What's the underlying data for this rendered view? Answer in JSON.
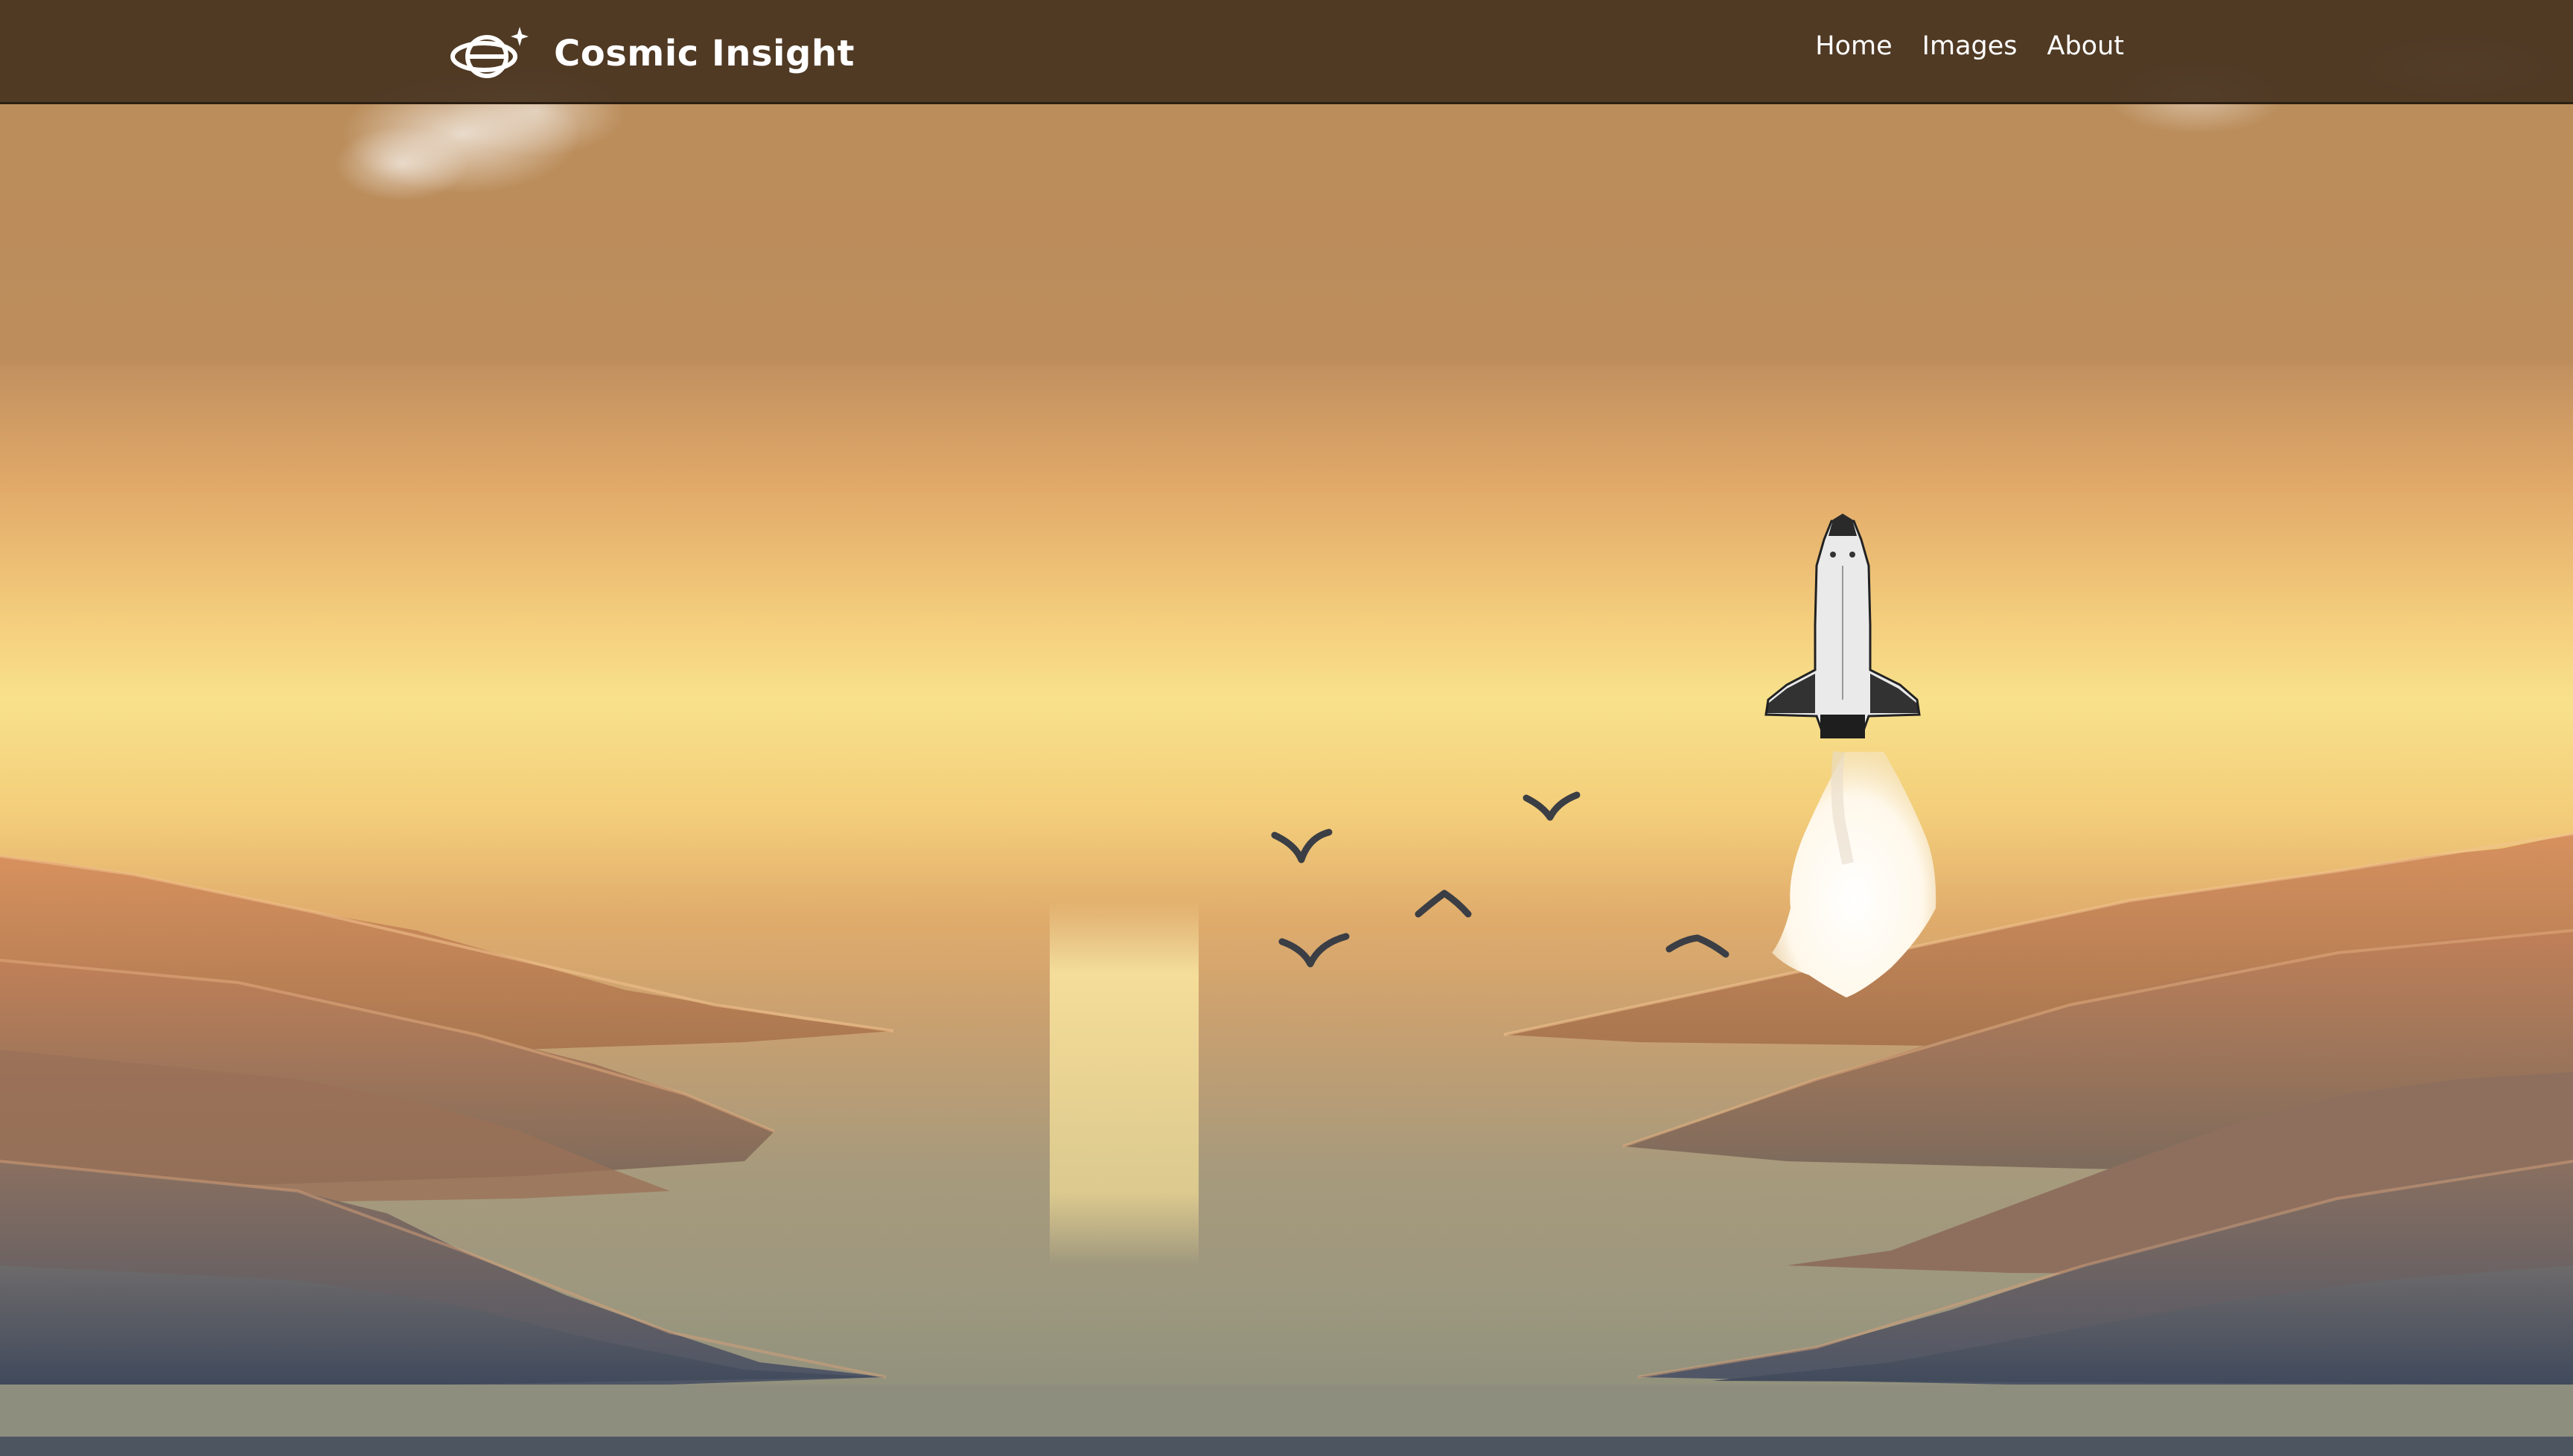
{
  "navbar": {
    "brand_name": "Cosmic Insight",
    "brand_icon": "planet-icon",
    "links": [
      {
        "label": "Home"
      },
      {
        "label": "Images"
      },
      {
        "label": "About"
      }
    ]
  },
  "hero": {
    "image": "space-shuttle-launch-over-sunset-lake-illustration",
    "colors": {
      "sky_top": "#b88c5a",
      "sky_glow": "#f8e08a",
      "water": "#8f8f7c",
      "navbar": "#48341f"
    }
  }
}
